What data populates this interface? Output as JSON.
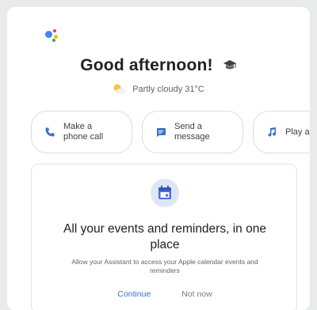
{
  "header": {
    "greeting": "Good afternoon!",
    "weather": "Partly cloudy 31°C",
    "logo_icon": "google-assistant-logo",
    "greeting_icon": "graduation-cap-icon",
    "weather_icon": "partly-cloudy-icon"
  },
  "suggestions": [
    {
      "label": "Make a phone call",
      "icon": "phone-icon"
    },
    {
      "label": "Send a message",
      "icon": "message-icon"
    },
    {
      "label": "Play a",
      "icon": "music-icon"
    }
  ],
  "card": {
    "icon": "calendar-icon",
    "title": "All your events and reminders, in one place",
    "description": "Allow your Assistant to access your Apple calendar events and reminders",
    "continue_label": "Continue",
    "not_now_label": "Not now"
  },
  "colors": {
    "accent": "#3c6fd0",
    "logo_blue": "#4285f4",
    "logo_red": "#ea4335",
    "logo_yellow": "#fbbc05",
    "logo_green": "#34a853"
  }
}
